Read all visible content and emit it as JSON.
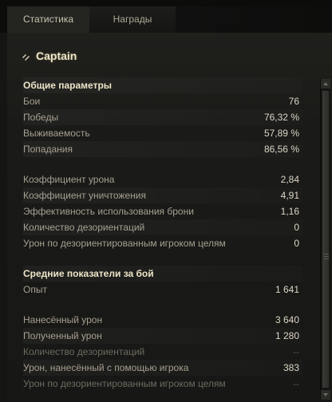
{
  "tabs": [
    {
      "label": "Статистика",
      "active": true
    },
    {
      "label": "Награды",
      "active": false
    }
  ],
  "vehicle": {
    "name": "Captain",
    "icon": "light-tank-icon"
  },
  "sections": [
    {
      "title": "Общие параметры",
      "groups": [
        [
          {
            "label": "Бои",
            "value": "76"
          },
          {
            "label": "Победы",
            "value": "76,32 %"
          },
          {
            "label": "Выживаемость",
            "value": "57,89 %"
          },
          {
            "label": "Попадания",
            "value": "86,56 %"
          }
        ],
        [
          {
            "label": "Коэффициент урона",
            "value": "2,84"
          },
          {
            "label": "Коэффициент уничтожения",
            "value": "4,91"
          },
          {
            "label": "Эффективность использования брони",
            "value": "1,16"
          },
          {
            "label": "Количество дезориентаций",
            "value": "0"
          },
          {
            "label": "Урон по дезориентированным игроком целям",
            "value": "0"
          }
        ]
      ]
    },
    {
      "title": "Средние показатели за бой",
      "groups": [
        [
          {
            "label": "Опыт",
            "value": "1 641"
          }
        ],
        [
          {
            "label": "Нанесённый урон",
            "value": "3 640"
          },
          {
            "label": "Полученный урон",
            "value": "1 280"
          },
          {
            "label": "Количество дезориентаций",
            "value": "--",
            "disabled": true
          },
          {
            "label": "Урон, нанесённый с помощью игрока",
            "value": "383"
          },
          {
            "label": "Урон по дезориентированным игроком целям",
            "value": "--",
            "disabled": true
          }
        ]
      ]
    }
  ],
  "colors": {
    "accent": "#eee7c8",
    "label": "#a6a090",
    "value": "#dcd6c6",
    "background": "#1a1a18"
  }
}
